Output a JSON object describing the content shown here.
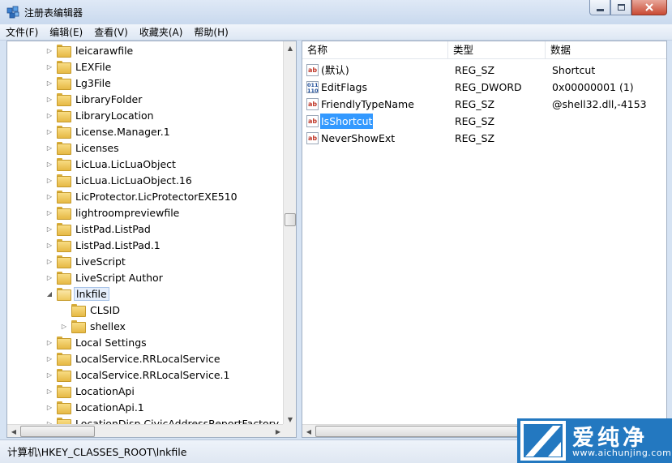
{
  "window": {
    "title": "注册表编辑器"
  },
  "menu": [
    {
      "label": "文件(F)"
    },
    {
      "label": "编辑(E)"
    },
    {
      "label": "查看(V)"
    },
    {
      "label": "收藏夹(A)"
    },
    {
      "label": "帮助(H)"
    }
  ],
  "tree": [
    {
      "label": "leicarawfile",
      "level": 0,
      "expander": "collapsed"
    },
    {
      "label": "LEXFile",
      "level": 0,
      "expander": "collapsed"
    },
    {
      "label": "Lg3File",
      "level": 0,
      "expander": "collapsed"
    },
    {
      "label": "LibraryFolder",
      "level": 0,
      "expander": "collapsed"
    },
    {
      "label": "LibraryLocation",
      "level": 0,
      "expander": "collapsed"
    },
    {
      "label": "License.Manager.1",
      "level": 0,
      "expander": "collapsed"
    },
    {
      "label": "Licenses",
      "level": 0,
      "expander": "collapsed"
    },
    {
      "label": "LicLua.LicLuaObject",
      "level": 0,
      "expander": "collapsed"
    },
    {
      "label": "LicLua.LicLuaObject.16",
      "level": 0,
      "expander": "collapsed"
    },
    {
      "label": "LicProtector.LicProtectorEXE510",
      "level": 0,
      "expander": "collapsed"
    },
    {
      "label": "lightroompreviewfile",
      "level": 0,
      "expander": "collapsed"
    },
    {
      "label": "ListPad.ListPad",
      "level": 0,
      "expander": "collapsed"
    },
    {
      "label": "ListPad.ListPad.1",
      "level": 0,
      "expander": "collapsed"
    },
    {
      "label": "LiveScript",
      "level": 0,
      "expander": "collapsed"
    },
    {
      "label": "LiveScript Author",
      "level": 0,
      "expander": "collapsed"
    },
    {
      "label": "lnkfile",
      "level": 0,
      "expander": "expanded",
      "selected": true,
      "open": true
    },
    {
      "label": "CLSID",
      "level": 1,
      "expander": "none"
    },
    {
      "label": "shellex",
      "level": 1,
      "expander": "collapsed"
    },
    {
      "label": "Local Settings",
      "level": 0,
      "expander": "collapsed"
    },
    {
      "label": "LocalService.RRLocalService",
      "level": 0,
      "expander": "collapsed"
    },
    {
      "label": "LocalService.RRLocalService.1",
      "level": 0,
      "expander": "collapsed"
    },
    {
      "label": "LocationApi",
      "level": 0,
      "expander": "collapsed"
    },
    {
      "label": "LocationApi.1",
      "level": 0,
      "expander": "collapsed"
    },
    {
      "label": "LocationDisp.CivicAddressReportFactory",
      "level": 0,
      "expander": "collapsed"
    }
  ],
  "list": {
    "columns": [
      "名称",
      "类型",
      "数据"
    ],
    "rows": [
      {
        "name": "(默认)",
        "type": "REG_SZ",
        "data": "Shortcut",
        "icon": "string-value-icon"
      },
      {
        "name": "EditFlags",
        "type": "REG_DWORD",
        "data": "0x00000001 (1)",
        "icon": "binary-value-icon"
      },
      {
        "name": "FriendlyTypeName",
        "type": "REG_SZ",
        "data": "@shell32.dll,-4153",
        "icon": "string-value-icon"
      },
      {
        "name": "IsShortcut",
        "type": "REG_SZ",
        "data": "",
        "icon": "string-value-icon",
        "selected": true
      },
      {
        "name": "NeverShowExt",
        "type": "REG_SZ",
        "data": "",
        "icon": "string-value-icon"
      }
    ]
  },
  "status": {
    "path": "计算机\\HKEY_CLASSES_ROOT\\lnkfile"
  },
  "watermark": {
    "title": "爱纯净",
    "url": "www.aichunjing.com"
  },
  "colors": {
    "selection": "#3399ff",
    "watermark_bg": "#2378c0"
  }
}
